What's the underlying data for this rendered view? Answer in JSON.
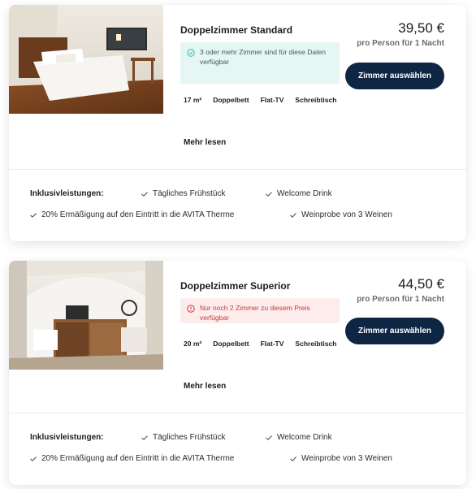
{
  "rooms": [
    {
      "name": "Doppelzimmer Standard",
      "availability_type": "ok",
      "availability_text": "3 oder mehr Zimmer sind für diese Daten verfügbar",
      "features": [
        "17 m²",
        "Doppelbett",
        "Flat-TV",
        "Schreibtisch"
      ],
      "more_label": "Mehr lesen",
      "price": "39,50 €",
      "per_person": "pro Person für 1 Nacht",
      "select_label": "Zimmer auswählen",
      "inclusive_label": "Inklusivleistungen:",
      "inclusive_items": [
        "Tägliches Frühstück",
        "Welcome Drink",
        "20% Ermäßigung auf den Eintritt in die AVITA Therme",
        "Weinprobe von 3 Weinen"
      ]
    },
    {
      "name": "Doppelzimmer Superior",
      "availability_type": "warn",
      "availability_text": "Nur noch 2 Zimmer zu diesem Preis verfügbar",
      "features": [
        "20 m²",
        "Doppelbett",
        "Flat-TV",
        "Schreibtisch"
      ],
      "more_label": "Mehr lesen",
      "price": "44,50 €",
      "per_person": "pro Person für 1 Nacht",
      "select_label": "Zimmer auswählen",
      "inclusive_label": "Inklusivleistungen:",
      "inclusive_items": [
        "Tägliches Frühstück",
        "Welcome Drink",
        "20% Ermäßigung auf den Eintritt in die AVITA Therme",
        "Weinprobe von 3 Weinen"
      ]
    }
  ],
  "colors": {
    "button_bg": "#0f2544",
    "ok_bg": "#e6f6f4",
    "warn_bg": "#fdecec",
    "warn_text": "#c83838"
  }
}
